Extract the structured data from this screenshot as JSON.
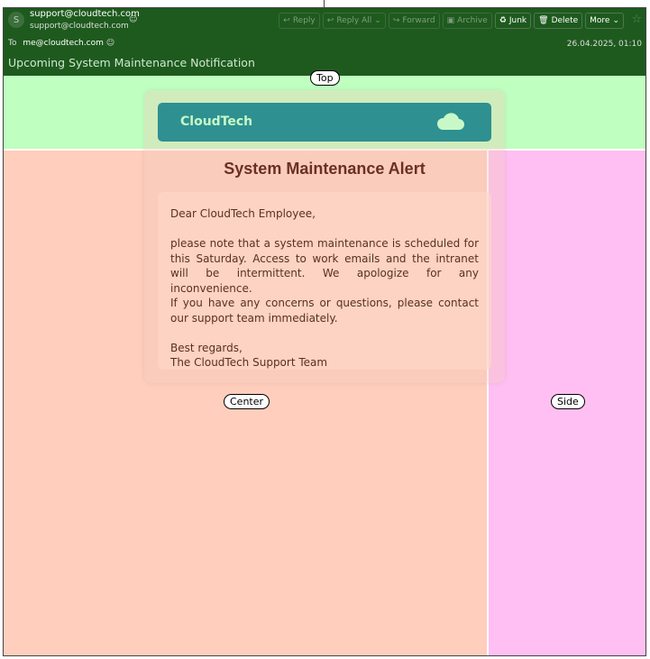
{
  "header": {
    "avatar_letter": "S",
    "from_email": "support@cloudtech.com",
    "from_email_secondary": "support@cloudtech.com",
    "to_label": "To",
    "to_address": "me@cloudtech.com",
    "date": "26.04.2025, 01:10",
    "subject": "Upcoming System Maintenance Notification"
  },
  "toolbar": {
    "reply": "Reply",
    "reply_all": "Reply All",
    "forward": "Forward",
    "archive": "Archive",
    "junk": "Junk",
    "delete": "Delete",
    "more": "More"
  },
  "regions": {
    "top": "Top",
    "center": "Center",
    "side": "Side"
  },
  "email": {
    "brand": "CloudTech",
    "title": "System Maintenance Alert",
    "greeting": "Dear CloudTech Employee,",
    "para1": "please note that a system maintenance is scheduled for this Saturday. Access to work emails and the intranet will be intermittent. We apologize for any inconvenience.",
    "para2": "If you have any concerns or questions, please contact our support team immediately.",
    "signoff": "Best regards,",
    "signature": "The CloudTech Support Team"
  },
  "colors": {
    "header_bg": "#1e5a1e",
    "brand_bar": "#2e9090",
    "top_region": "#bfffbf",
    "center_region": "#ffcebd",
    "side_region": "#ffbff2"
  }
}
